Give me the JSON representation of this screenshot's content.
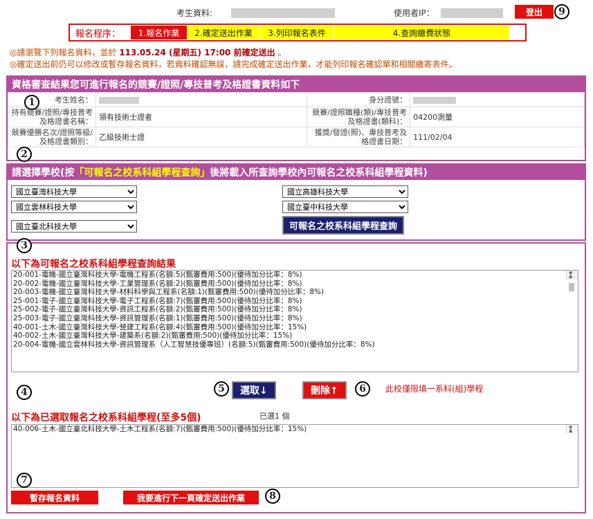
{
  "header": {
    "examinee_label": "考生資料:",
    "ip_label": "使用者IP：",
    "logout_label": "登出"
  },
  "steps": {
    "label": "報名程序：",
    "items": [
      "1.報名作業",
      "2.確定送出作業",
      "3.列印報名表件",
      "4.查詢繳費狀態"
    ]
  },
  "notice": {
    "line1_pre": "◎請瀏覽下列報名資料，並於",
    "line1_bold": "113.05.24 (星期五) 17:00 前確定送出",
    "line1_post": "。",
    "line2": "◎確定送出前仍可以修改或暫存報名資料，若資料確認無誤，請完成確定送出作業，才能列印報名確認單和相關繳寄表件。"
  },
  "qualification": {
    "title": "資格審查結果您可進行報名的競賽/證照/專技普考及格證書資料如下",
    "name_label": "考生姓名：",
    "id_label": "身分證號：",
    "cert_name_label": "持有競賽/證照/專技普考及格證書名稱：",
    "cert_name_value": "領有技術士證者",
    "cert_type_label": "競賽/證照職種(類)/專技普考及格證書(類科)：",
    "cert_type_value": "04200測量",
    "rank_label": "競賽優勝名次/證照等級/及格證書類別：",
    "rank_value": "乙級技術士證",
    "date_label": "獲獎/發證(照)、專技普考及格證書日期：",
    "date_value": "111/02/04"
  },
  "school_select": {
    "title_pre": "請選擇學校(按",
    "title_highlight": "「可報名之校系科組學程查詢」",
    "title_post": "後將載入所查詢學校內可報名之校系科組學程資料)",
    "schools": [
      "國立臺灣科技大學",
      "國立高雄科技大學",
      "國立雲林科技大學",
      "國立臺中科技大學",
      "國立臺北科技大學"
    ],
    "query_button": "可報名之校系科組學程查詢"
  },
  "results": {
    "heading": "以下為可報名之校系科組學程查詢結果",
    "items": [
      "20-001-電機-國立臺灣科技大學-電機工程系(名額:5)(甄審費用:500)(優待加分比率：8%)",
      "20-002-電機-國立臺灣科技大學-工業管理系(名額:2)(甄審費用:500)(優待加分比率：8%)",
      "20-003-電機-國立臺灣科技大學-材料科學與工程系(名額:1)(甄審費用:500)(優待加分比率：8%)",
      "25-001-電子-國立臺灣科技大學-電子工程系(名額:7)(甄審費用:500)(優待加分比率：8%)",
      "25-002-電子-國立臺灣科技大學-資訊工程系(名額:2)(甄審費用:500)(優待加分比率：8%)",
      "25-003-電子-國立臺灣科技大學-資訊管理系(名額:1)(甄審費用:500)(優待加分比率：8%)",
      "40-001-土木-國立臺灣科技大學-營建工程系(名額:4)(甄審費用:500)(優待加分比率：15%)",
      "40-002-土木-國立臺灣科技大學-建築系(名額:2)(甄審費用:500)(優待加分比率：15%)",
      "20-004-電機-國立雲林科技大學-資訊管理系（人工智慧技優專班）(名額:5)(甄審費用:500)(優待加分比率：8%)"
    ],
    "select_button": "選取↓",
    "delete_button": "刪除↑",
    "note": "此校僅限填一系科(組)學程"
  },
  "selected": {
    "heading": "以下為已選取報名之校系科組學程(至多5個)",
    "count_text": "已選1 個",
    "items": [
      "40-006-土木-國立臺北科技大學-土木工程系(名額:7)(甄審費用:500)(優待加分比率：15%)"
    ],
    "save_button": "暫存報名資料",
    "next_button": "我要進行下一頁確定送出作業"
  },
  "markers": [
    "1",
    "2",
    "3",
    "4",
    "5",
    "6",
    "7",
    "8",
    "9"
  ]
}
